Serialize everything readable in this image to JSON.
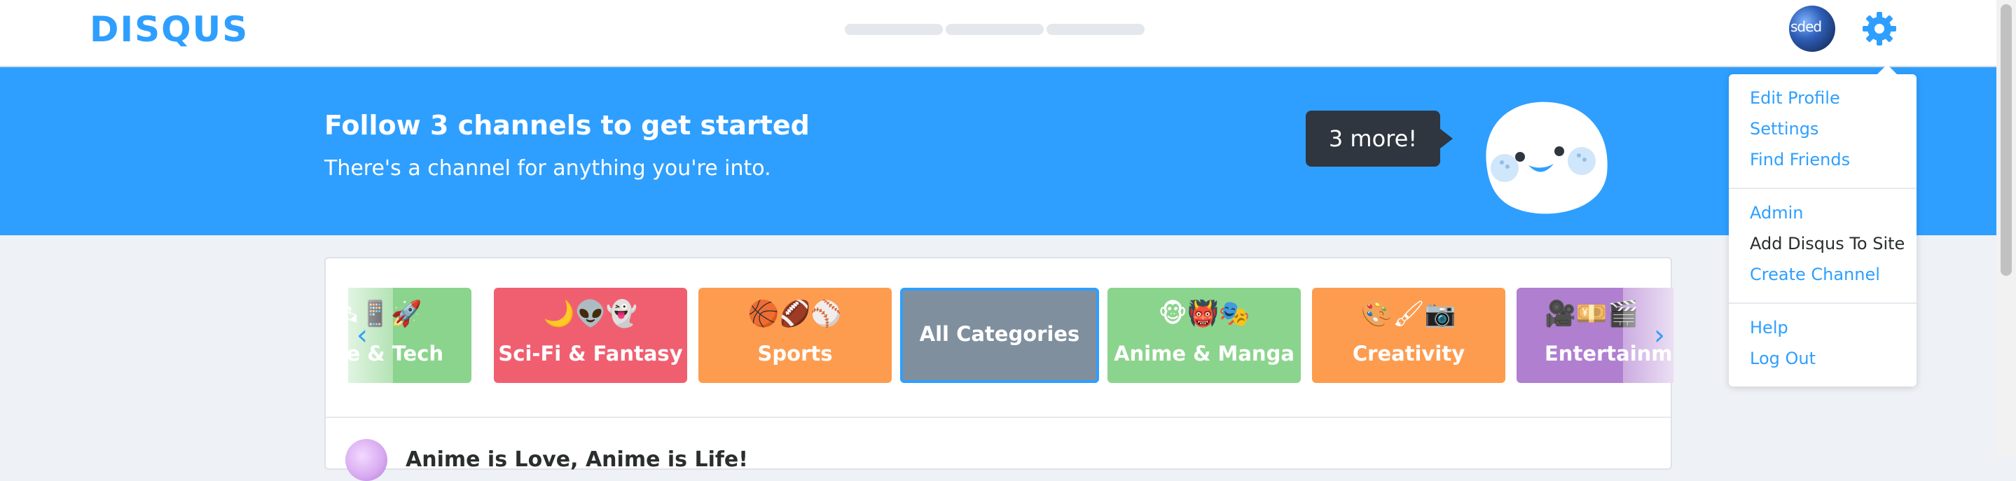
{
  "header": {
    "logo": "DISQUS",
    "avatar_text": "sded"
  },
  "banner": {
    "title": "Follow 3 channels to get started",
    "subtitle": "There's a channel for anything you're into.",
    "callout": "3 more!"
  },
  "categories": [
    {
      "label": "ence & Tech",
      "emoji": "🛰📱🚀",
      "color": "#8bd48d"
    },
    {
      "label": "Sci-Fi & Fantasy",
      "emoji": "🌙👽👻",
      "color": "#f05f70"
    },
    {
      "label": "Sports",
      "emoji": "🏀🏈⚾",
      "color": "#fd9c4f"
    },
    {
      "label": "All Categories",
      "emoji": "",
      "color": "#7f8f9e"
    },
    {
      "label": "Anime & Manga",
      "emoji": "🐵👹🎭",
      "color": "#8bd48d"
    },
    {
      "label": "Creativity",
      "emoji": "🎨🖌📷",
      "color": "#fd9c4f"
    },
    {
      "label": "Entertainm",
      "emoji": "🎥💴🎬",
      "color": "#b07fd0"
    }
  ],
  "carousel": {
    "prev_icon": "‹",
    "next_icon": "›"
  },
  "feed": {
    "first_row_title": "Anime is Love, Anime is Life!"
  },
  "dropdown": {
    "group1": [
      "Edit Profile",
      "Settings",
      "Find Friends"
    ],
    "group2": [
      "Admin",
      "Add Disqus To Site",
      "Create Channel"
    ],
    "group3": [
      "Help",
      "Log Out"
    ]
  },
  "colors": {
    "brand": "#2e9fff",
    "callout_bg": "#2f3640"
  }
}
